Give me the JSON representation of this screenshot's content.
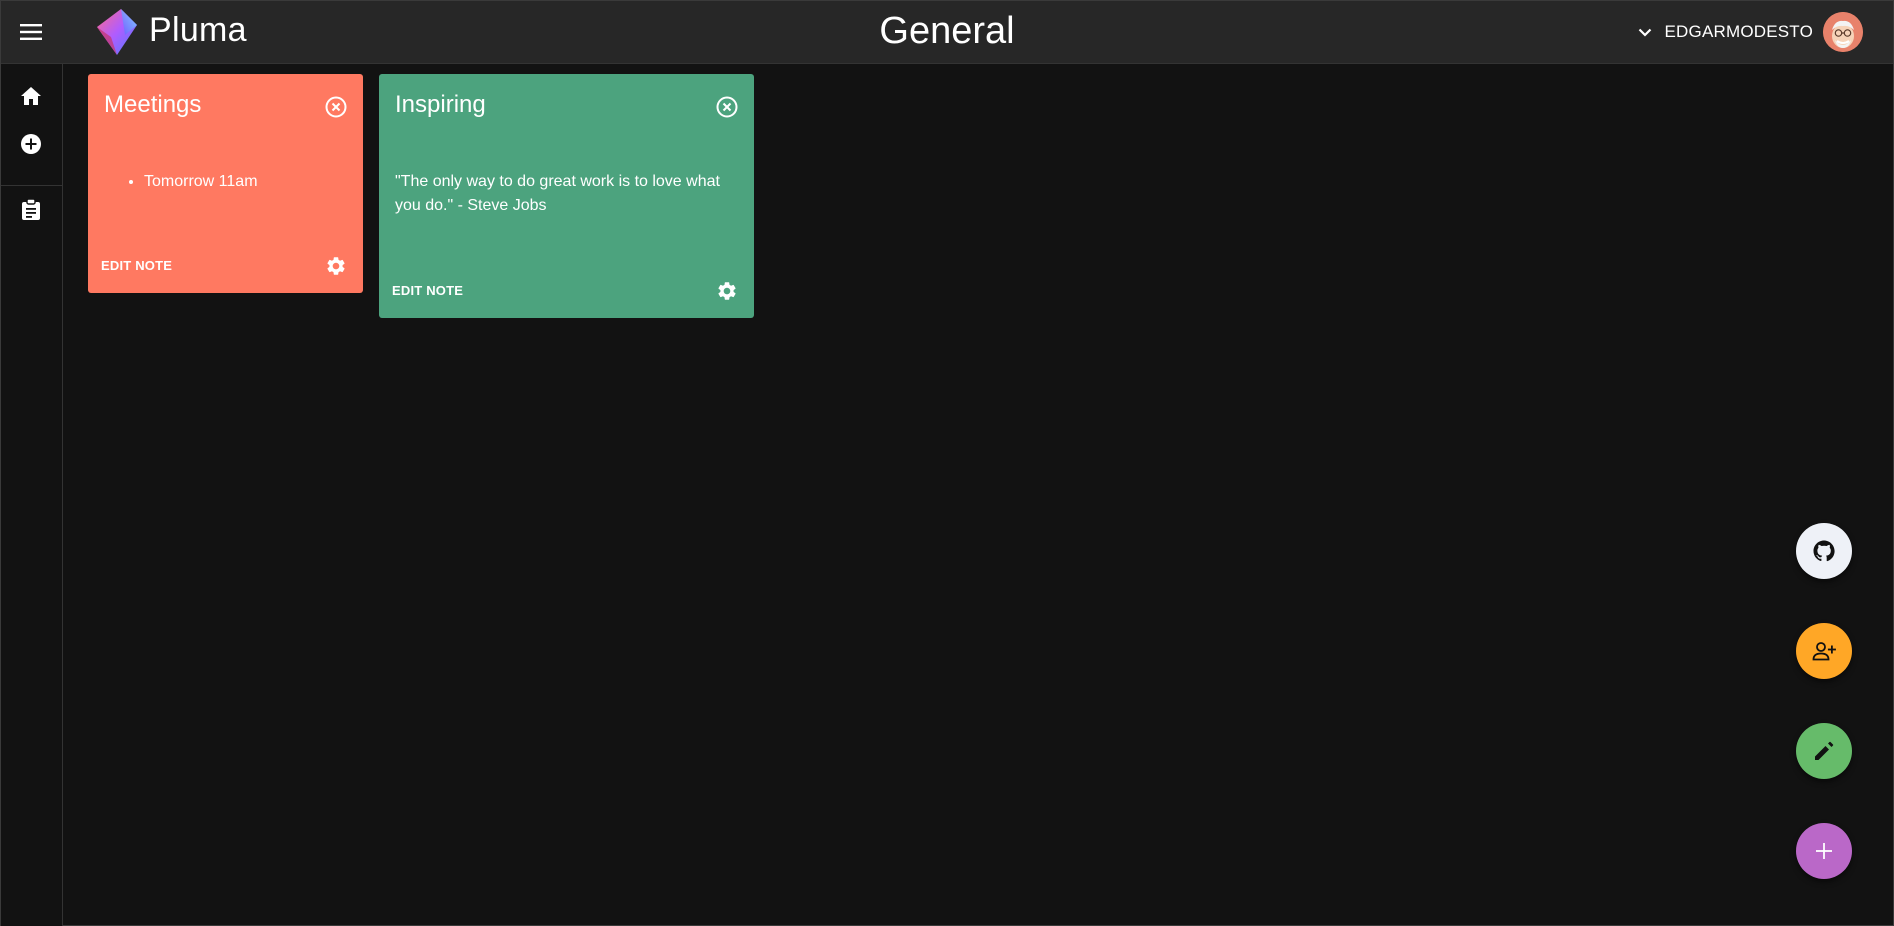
{
  "app": {
    "brand": "Pluma",
    "page_title": "General",
    "username": "EDGARMODESTO"
  },
  "sidebar": {
    "items": [
      {
        "icon": "home-icon"
      },
      {
        "icon": "add-circle-icon"
      },
      {
        "icon": "clipboard-icon"
      }
    ]
  },
  "notes": [
    {
      "title": "Meetings",
      "color": "#ff7961",
      "list_items": [
        "Tomorrow 11am"
      ],
      "edit_label": "EDIT NOTE"
    },
    {
      "title": "Inspiring",
      "color": "#4ca37e",
      "text": "\"The only way to do great work is to love what you do.\" - Steve Jobs",
      "edit_label": "EDIT NOTE"
    }
  ],
  "fabs": {
    "github": {
      "icon": "github-icon",
      "color": "#eef1f7"
    },
    "share": {
      "icon": "person-add-icon",
      "color": "#ffa726"
    },
    "edit": {
      "icon": "pencil-icon",
      "color": "#66bb6a"
    },
    "add": {
      "icon": "plus-icon",
      "color": "#ba68c8"
    }
  }
}
